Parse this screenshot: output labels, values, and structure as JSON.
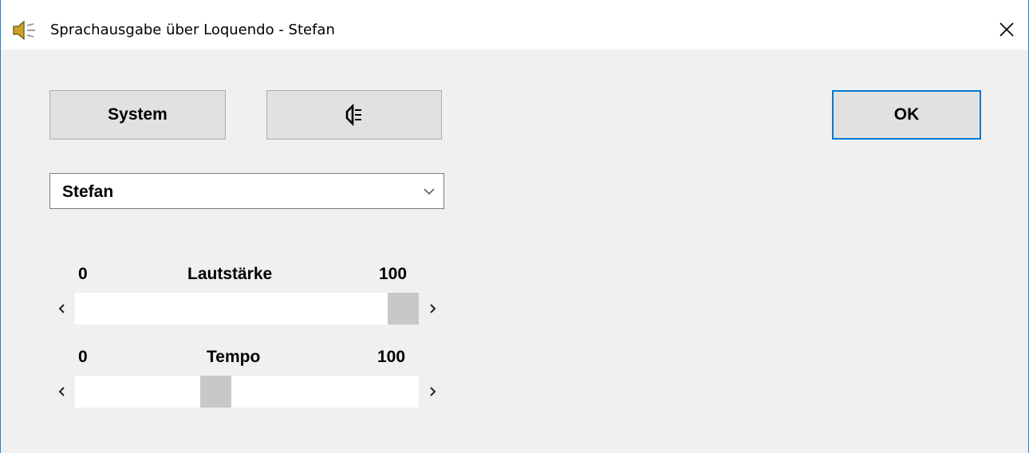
{
  "window": {
    "title": "Sprachausgabe über Loquendo - Stefan",
    "title_icon": "speaker-icon",
    "close_icon": "close-icon"
  },
  "buttons": {
    "system_label": "System",
    "speak_icon": "speaker-icon",
    "ok_label": "OK"
  },
  "voice_select": {
    "selected": "Stefan",
    "icon": "chevron-down-icon"
  },
  "volume": {
    "min_label": "0",
    "label": "Lautstärke",
    "max_label": "100",
    "value_fraction": 1.0
  },
  "tempo": {
    "min_label": "0",
    "label": "Tempo",
    "max_label": "100",
    "value_fraction": 0.4
  },
  "colors": {
    "window_border": "#1f7fd6",
    "ok_border": "#0078d7",
    "button_face": "#e1e1e1",
    "thumb": "#c8c8c8"
  }
}
